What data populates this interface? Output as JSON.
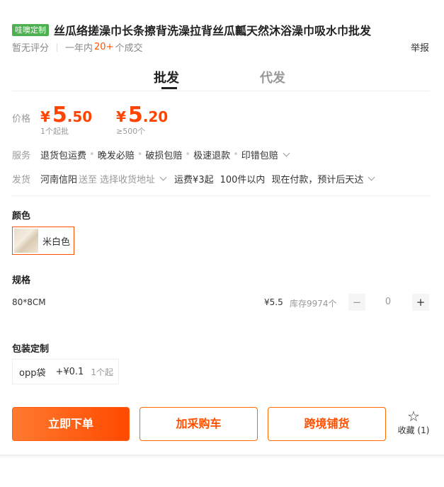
{
  "product": {
    "tag": "哇噢定制",
    "title": "丝瓜络搓澡巾长条擦背洗澡拉背丝瓜瓤天然沐浴澡巾吸水巾批发",
    "rating": "暂无评分",
    "sales_prefix": "一年内",
    "sales_count": "20+",
    "sales_suffix": "个成交",
    "report": "举报"
  },
  "tabs": [
    {
      "label": "批发",
      "active": true
    },
    {
      "label": "代发",
      "active": false
    }
  ],
  "price": {
    "label": "价格",
    "tiers": [
      {
        "currency": "¥",
        "int": "5",
        "dec": ".50",
        "note": "1个起批"
      },
      {
        "currency": "¥",
        "int": "5",
        "dec": ".20",
        "note": "≥500个"
      }
    ]
  },
  "service": {
    "label": "服务",
    "items": [
      "退货包运费",
      "晚发必赔",
      "破损包赔",
      "极速退款",
      "印错包赔"
    ]
  },
  "shipping": {
    "label": "发货",
    "origin": "河南信阳",
    "to": "送至",
    "address_placeholder": "选择收货地址",
    "fee": "运费¥3起",
    "qty_range": "100件以内",
    "delivery": "现在付款，预计后天达"
  },
  "color": {
    "title": "颜色",
    "options": [
      {
        "label": "米白色",
        "selected": true
      }
    ]
  },
  "spec": {
    "title": "规格",
    "rows": [
      {
        "name": "80*8CM",
        "price": "¥5.5",
        "stock": "库存9974个",
        "qty": "0"
      }
    ],
    "minus": "−",
    "plus": "+"
  },
  "packaging": {
    "title": "包装定制",
    "option": {
      "name": "opp袋",
      "price": "+¥0.1",
      "moq": "1个起"
    }
  },
  "actions": {
    "buy": "立即下单",
    "cart": "加采购车",
    "cross": "跨境铺货",
    "fav": "收藏 (1)"
  },
  "colors": {
    "accent": "#ff5000",
    "tag_green": "#4cb050"
  }
}
